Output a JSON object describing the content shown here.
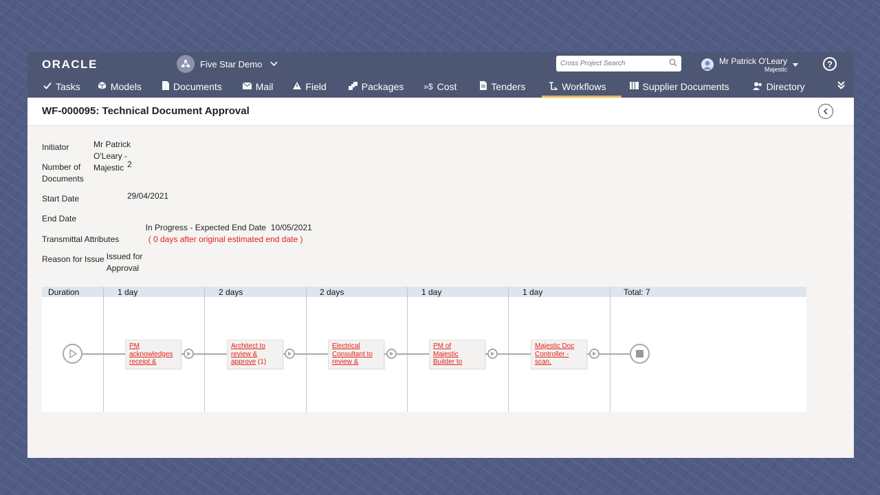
{
  "header": {
    "logo": "ORACLE",
    "project": "Five Star Demo",
    "search_placeholder": "Cross Project Search",
    "user_name": "Mr Patrick O'Leary",
    "user_org": "Majestic",
    "help": "?"
  },
  "nav": [
    {
      "label": "Tasks",
      "icon": "check-icon"
    },
    {
      "label": "Models",
      "icon": "cube-icon"
    },
    {
      "label": "Documents",
      "icon": "document-icon"
    },
    {
      "label": "Mail",
      "icon": "mail-icon"
    },
    {
      "label": "Field",
      "icon": "warning-icon"
    },
    {
      "label": "Packages",
      "icon": "packages-icon"
    },
    {
      "label": "Cost",
      "icon": "cost-icon"
    },
    {
      "label": "Tenders",
      "icon": "tenders-icon"
    },
    {
      "label": "Workflows",
      "icon": "workflow-icon",
      "active": true
    },
    {
      "label": "Supplier Documents",
      "icon": "supplier-icon"
    },
    {
      "label": "Directory",
      "icon": "people-icon"
    }
  ],
  "page": {
    "title": "WF-000095: Technical Document Approval"
  },
  "details": {
    "initiator_label": "Initiator",
    "initiator": "Mr Patrick O'Leary - Majestic",
    "num_docs_label_1": "Number of",
    "num_docs_label_2": "Documents",
    "num_docs": "2",
    "start_label": "Start Date",
    "start": "29/04/2021",
    "end_label": "End Date",
    "end_status": "In Progress - Expected End Date  10/05/2021",
    "end_note": "( 0 days after original estimated end date )",
    "transmittal_label": "Transmittal Attributes",
    "reason_label": "Reason for Issue",
    "reason": "Issued for Approval"
  },
  "workflow": {
    "duration_label": "Duration",
    "total_label": "Total: 7",
    "steps": [
      {
        "duration": "1 day",
        "lines": [
          "PM",
          "acknowledges",
          "receipt &"
        ],
        "count": ""
      },
      {
        "duration": "2 days",
        "lines": [
          "Architect to",
          "review &",
          "approve"
        ],
        "count": "(1)"
      },
      {
        "duration": "2 days",
        "lines": [
          "Electrical",
          "Consultant to",
          "review &"
        ],
        "count": ""
      },
      {
        "duration": "1 day",
        "lines": [
          "PM of",
          "Majestic",
          "Builder to"
        ],
        "count": ""
      },
      {
        "duration": "1 day",
        "lines": [
          "Majestic Doc",
          "Controller -",
          "scan,"
        ],
        "count": ""
      }
    ]
  }
}
